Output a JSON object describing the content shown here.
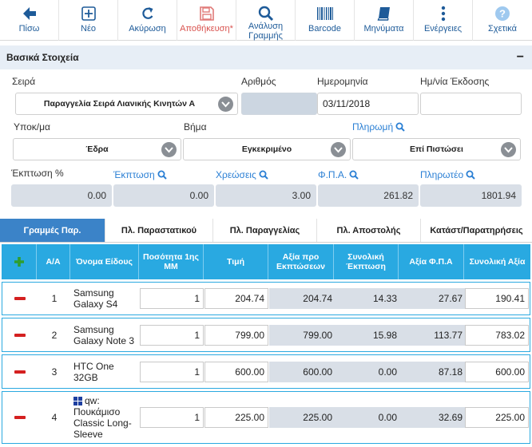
{
  "toolbar": {
    "back": "Πίσω",
    "new": "Νέο",
    "cancel": "Ακύρωση",
    "save": "Αποθήκευση",
    "save_marker": "*",
    "line_analysis": "Ανάλυση Γραμμής",
    "barcode": "Barcode",
    "messages": "Μηνύματα",
    "actions": "Ενέργειες",
    "about": "Σχετικά"
  },
  "section": {
    "title": "Βασικά Στοιχεία",
    "collapse": "−"
  },
  "form": {
    "series_label": "Σειρά",
    "series_value": "Παραγγελία Σειρά Λιανικής Κινητών Α",
    "number_label": "Αριθμός",
    "number_value": "",
    "date_label": "Ημερομηνία",
    "date_value": "03/11/2018",
    "issue_date_label": "Ημ/νία Έκδοσης",
    "issue_date_value": "",
    "branch_label": "Υποκ/μα",
    "branch_value": "Έδρα",
    "step_label": "Βήμα",
    "step_value": "Εγκεκριμένο",
    "payment_label": "Πληρωμή",
    "payment_value": "Επί Πιστώσει",
    "discount_pct_label": "Έκπτωση %",
    "discount_pct_value": "0.00",
    "discount_label": "Έκπτωση",
    "discount_value": "0.00",
    "charges_label": "Χρεώσεις",
    "charges_value": "3.00",
    "vat_label": "Φ.Π.Α.",
    "vat_value": "261.82",
    "payable_label": "Πληρωτέο",
    "payable_value": "1801.94"
  },
  "tabs": [
    {
      "label": "Γραμμές Παρ.",
      "active": true
    },
    {
      "label": "Πλ. Παραστατικού",
      "active": false
    },
    {
      "label": "Πλ. Παραγγελίας",
      "active": false
    },
    {
      "label": "Πλ. Αποστολής",
      "active": false
    },
    {
      "label": "Κατάστ/Παρατηρήσεις",
      "active": false
    }
  ],
  "grid": {
    "columns": {
      "add": "+",
      "index": "Α/Α",
      "name": "Όνομα Είδους",
      "qty": "Ποσότητα 1ης ΜΜ",
      "price": "Τιμή",
      "pre_discount": "Αξία προ Εκπτώσεων",
      "total_discount": "Συνολική Έκπτωση",
      "vat_value": "Αξία Φ.Π.Α",
      "total_value": "Συνολική Αξία"
    },
    "rows": [
      {
        "index": "1",
        "code": "",
        "name": "Samsung Galaxy S4",
        "qty": "1",
        "price": "204.74",
        "pre_discount": "204.74",
        "total_discount": "14.33",
        "vat": "27.67",
        "total": "190.41"
      },
      {
        "index": "2",
        "code": "",
        "name": "Samsung Galaxy Note 3",
        "qty": "1",
        "price": "799.00",
        "pre_discount": "799.00",
        "total_discount": "15.98",
        "vat": "113.77",
        "total": "783.02"
      },
      {
        "index": "3",
        "code": "",
        "name": "HTC One 32GB",
        "qty": "1",
        "price": "600.00",
        "pre_discount": "600.00",
        "total_discount": "0.00",
        "vat": "87.18",
        "total": "600.00"
      },
      {
        "index": "4",
        "code": "qw:",
        "name": "Πουκάμισο Classic Long-Sleeve",
        "qty": "1",
        "price": "225.00",
        "pre_discount": "225.00",
        "total_discount": "0.00",
        "vat": "32.69",
        "total": "225.00"
      }
    ]
  },
  "colors": {
    "accent": "#29a9e1",
    "link": "#2a7fd4",
    "toolbar_text": "#1e5b99",
    "delete": "#d42020",
    "active_tab": "#3b83c8"
  }
}
